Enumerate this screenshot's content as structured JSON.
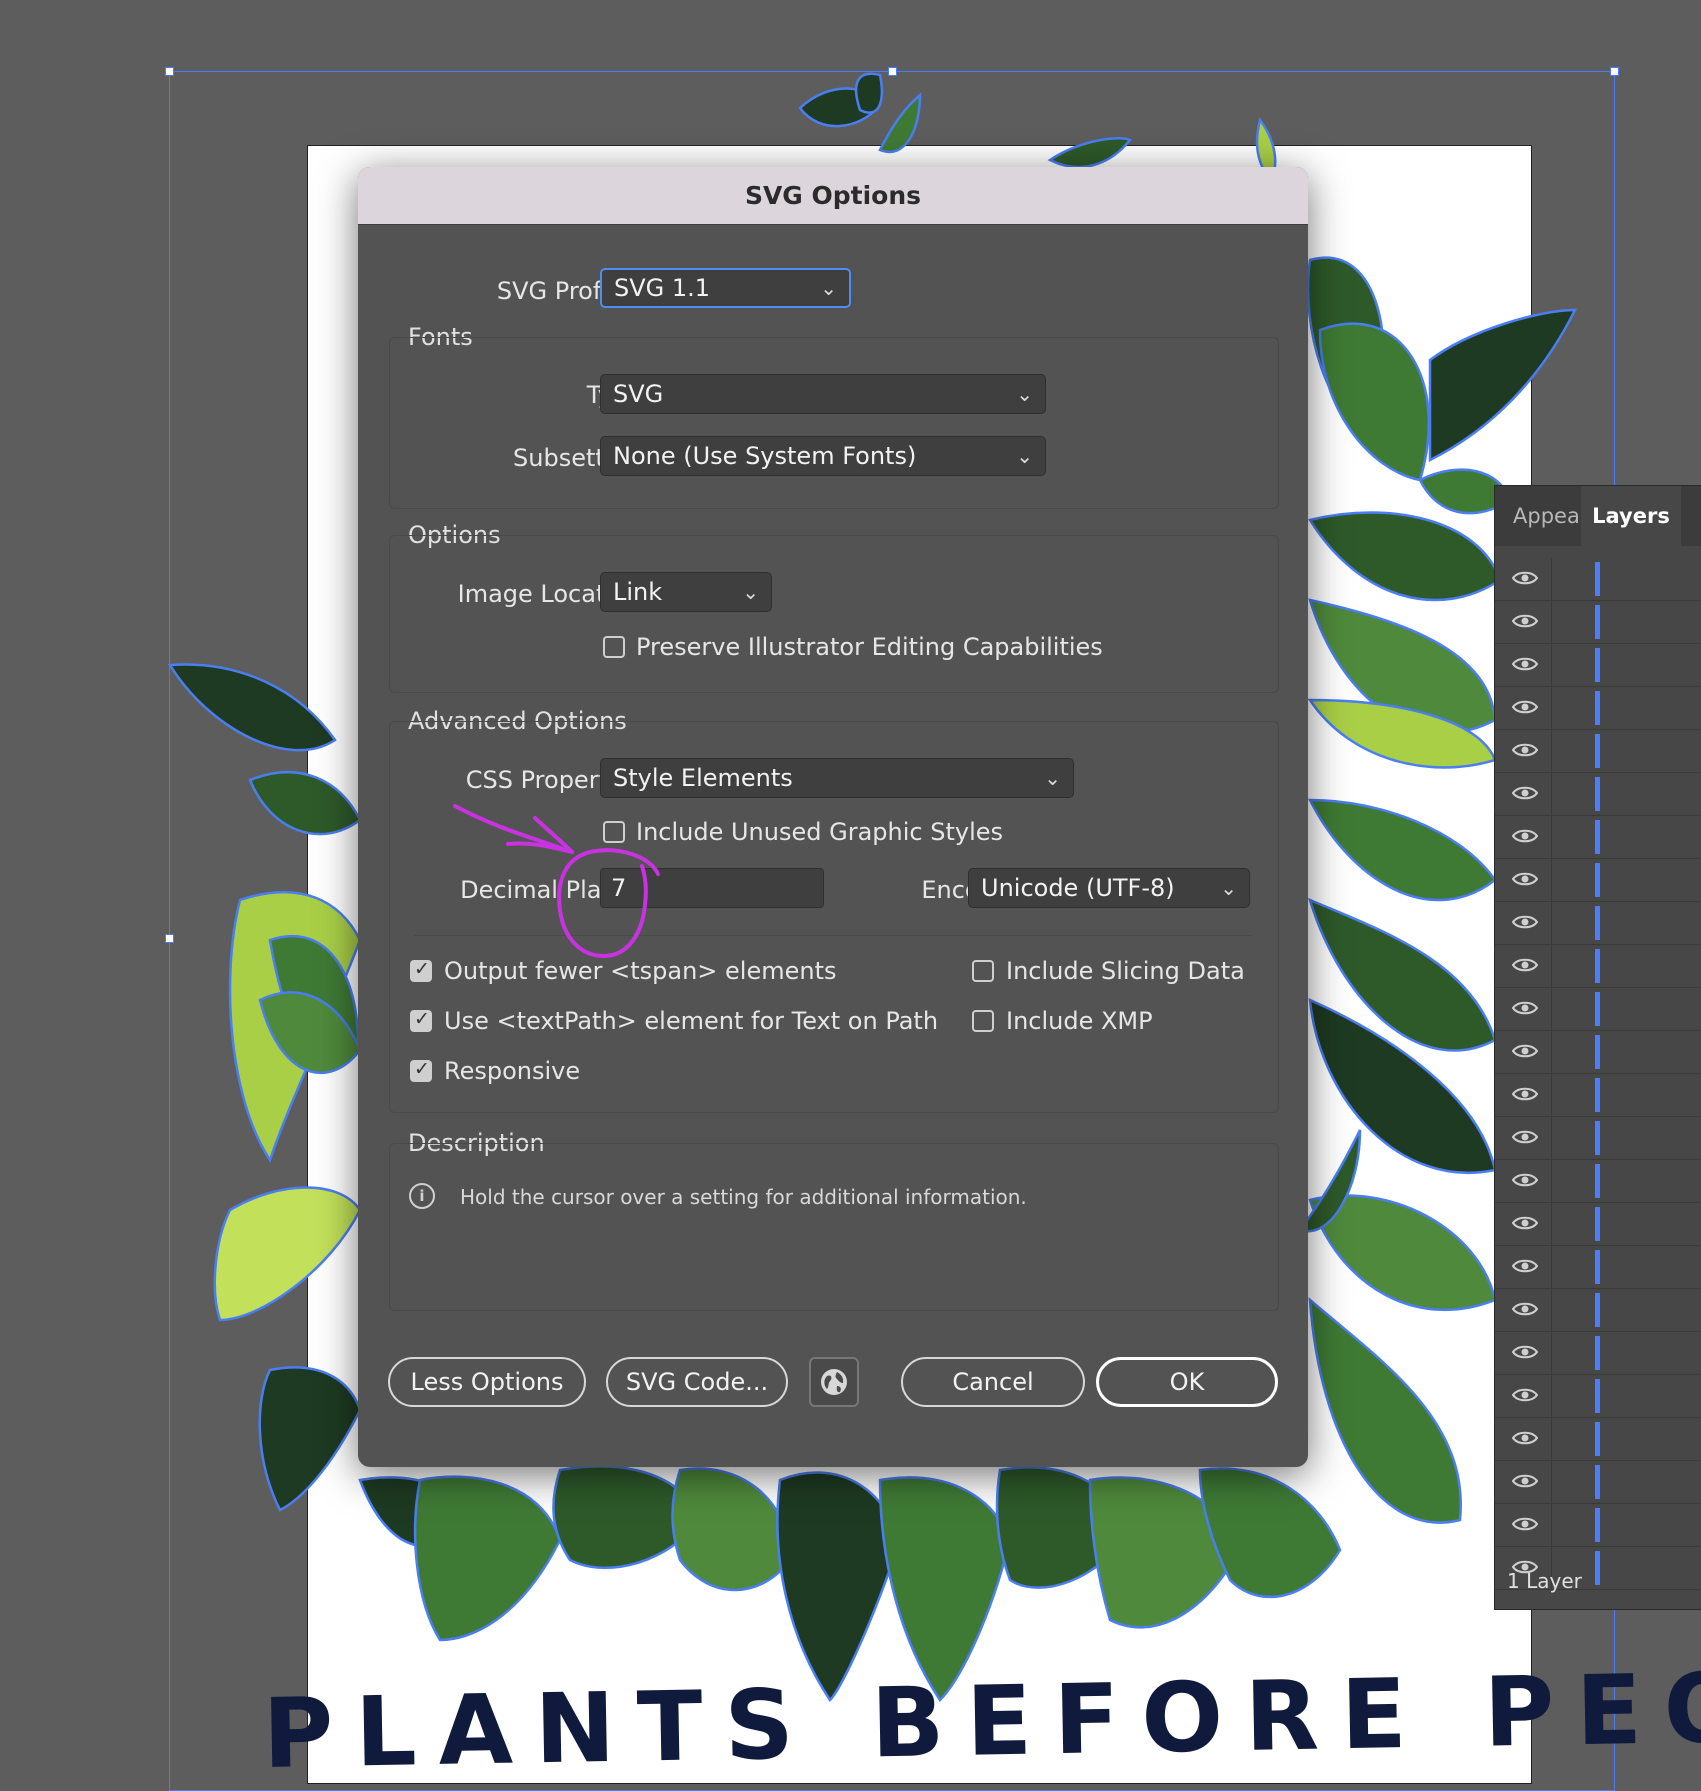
{
  "poster": {
    "text": "PLANTS BEFORE PEOPLE"
  },
  "layers_panel": {
    "tabs": [
      "Appea",
      "Layers"
    ],
    "footer": "1 Layer",
    "row_count": 24
  },
  "dialog": {
    "title": "SVG Options",
    "svg_profiles": {
      "label": "SVG Profiles:",
      "value": "SVG 1.1"
    },
    "fonts": {
      "title": "Fonts",
      "type": {
        "label": "Type:",
        "value": "SVG"
      },
      "subsetting": {
        "label": "Subsetting:",
        "value": "None (Use System Fonts)"
      }
    },
    "options": {
      "title": "Options",
      "image_location": {
        "label": "Image Location:",
        "value": "Link"
      },
      "preserve": {
        "label": "Preserve Illustrator Editing Capabilities",
        "checked": false
      }
    },
    "advanced": {
      "title": "Advanced Options",
      "css_properties": {
        "label": "CSS Properties:",
        "value": "Style Elements"
      },
      "include_unused": {
        "label": "Include Unused Graphic Styles",
        "checked": false
      },
      "decimal_places": {
        "label": "Decimal Places:",
        "value": "7"
      },
      "encoding": {
        "label": "Encoding:",
        "value": "Unicode (UTF-8)"
      },
      "output_fewer": {
        "label": "Output fewer <tspan> elements",
        "checked": true
      },
      "use_textpath": {
        "label": "Use <textPath> element for Text on Path",
        "checked": true
      },
      "responsive": {
        "label": "Responsive",
        "checked": true
      },
      "slicing": {
        "label": "Include Slicing Data",
        "checked": false
      },
      "xmp": {
        "label": "Include XMP",
        "checked": false
      }
    },
    "description": {
      "title": "Description",
      "text": "Hold the cursor over a setting for additional information."
    },
    "buttons": {
      "less_options": "Less Options",
      "svg_code": "SVG Code...",
      "cancel": "Cancel",
      "ok": "OK"
    }
  },
  "colors": {
    "accent": "#4c8ef5",
    "annotation": "#c832e0",
    "leaf_dark": "#1e3a22",
    "leaf_mid": "#3f7a35",
    "leaf_light": "#a9cf47",
    "leaf_outline": "#4a7ef2"
  }
}
